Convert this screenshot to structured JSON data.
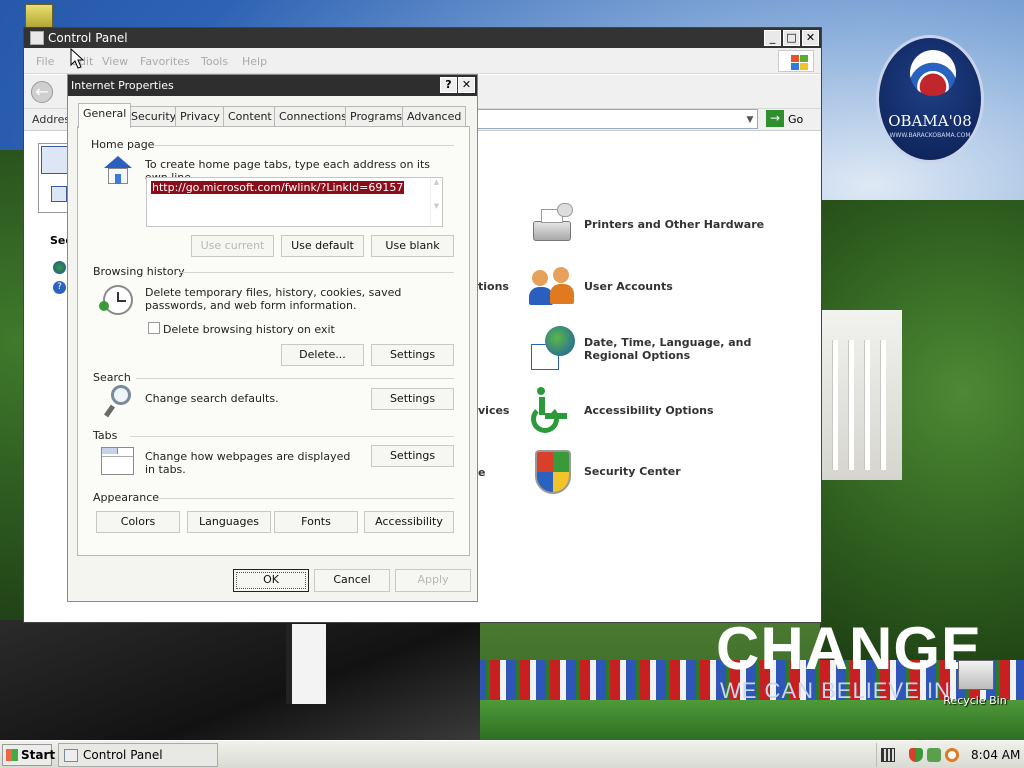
{
  "desktop": {
    "campaign_logo_text": "OBAMA'08",
    "campaign_logo_sub": "WWW.BARACKOBAMA.COM",
    "slogan_main": "CHANGE",
    "slogan_sub": "WE CAN BELIEVE IN",
    "recycle_bin_label": "Recycle Bin"
  },
  "control_panel": {
    "title": "Control Panel",
    "menu": [
      "File",
      "Edit",
      "View",
      "Favorites",
      "Tools",
      "Help"
    ],
    "address_label": "Address",
    "go_label": "Go",
    "side_heading": "See",
    "categories": [
      {
        "label": "Printers and Other Hardware",
        "icon": "printer-icon"
      },
      {
        "label": "User Accounts",
        "icon": "user-accounts-icon"
      },
      {
        "label": "Date, Time, Language, and Regional Options",
        "icon": "date-time-icon"
      },
      {
        "label": "Accessibility Options",
        "icon": "accessibility-icon"
      },
      {
        "label": "Security Center",
        "icon": "security-shield-icon"
      }
    ],
    "partial_labels": [
      "tions",
      "vices",
      "e"
    ]
  },
  "dialog": {
    "title": "Internet Properties",
    "help_glyph": "?",
    "close_glyph": "✕",
    "tabs": [
      "General",
      "Security",
      "Privacy",
      "Content",
      "Connections",
      "Programs",
      "Advanced"
    ],
    "active_tab": "General",
    "home_page": {
      "heading": "Home page",
      "description": "To create home page tabs, type each address on its own line.",
      "url": "http://go.microsoft.com/fwlink/?LinkId=69157",
      "buttons": [
        "Use current",
        "Use default",
        "Use blank"
      ]
    },
    "browsing_history": {
      "heading": "Browsing history",
      "description": "Delete temporary files, history, cookies, saved passwords, and web form information.",
      "checkbox_label": "Delete browsing history on exit",
      "checkbox_checked": false,
      "buttons": [
        "Delete...",
        "Settings"
      ]
    },
    "search": {
      "heading": "Search",
      "description": "Change search defaults.",
      "button": "Settings"
    },
    "tabs_section": {
      "heading": "Tabs",
      "description": "Change how webpages are displayed in tabs.",
      "button": "Settings"
    },
    "appearance": {
      "heading": "Appearance",
      "buttons": [
        "Colors",
        "Languages",
        "Fonts",
        "Accessibility"
      ]
    },
    "footer_buttons": [
      "OK",
      "Cancel",
      "Apply"
    ]
  },
  "taskbar": {
    "start_label": "Start",
    "task_label": "Control Panel",
    "clock": "8:04 AM"
  }
}
